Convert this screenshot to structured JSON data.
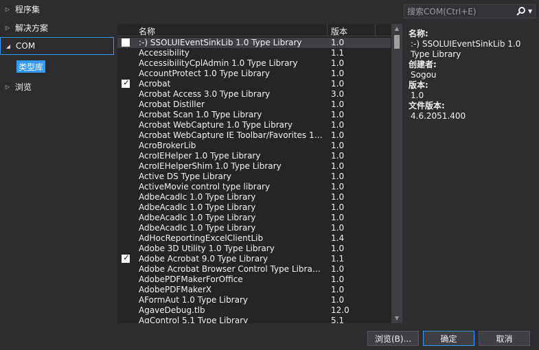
{
  "nav": {
    "items": [
      {
        "label": "程序集",
        "arrow": "▷"
      },
      {
        "label": "解决方案",
        "arrow": "▷"
      },
      {
        "label": "COM",
        "arrow": "◢"
      },
      {
        "label": "浏览",
        "arrow": "▷"
      }
    ],
    "child_label": "类型库"
  },
  "search": {
    "placeholder": "搜索COM(Ctrl+E)"
  },
  "list": {
    "columns": {
      "name": "名称",
      "version": "版本"
    },
    "rows": [
      {
        "name": ":-) SSOLUIEventSinkLib 1.0 Type Library",
        "version": "1.0",
        "checked": false,
        "selected": true
      },
      {
        "name": "Accessibility",
        "version": "1.1"
      },
      {
        "name": "AccessibilityCplAdmin 1.0 Type Library",
        "version": "1.0"
      },
      {
        "name": "AccountProtect 1.0 Type Library",
        "version": "1.0"
      },
      {
        "name": "Acrobat",
        "version": "1.0",
        "checked": true
      },
      {
        "name": "Acrobat Access 3.0 Type Library",
        "version": "3.0"
      },
      {
        "name": "Acrobat Distiller",
        "version": "1.0"
      },
      {
        "name": "Acrobat Scan 1.0 Type Library",
        "version": "1.0"
      },
      {
        "name": "Acrobat WebCapture 1.0 Type Library",
        "version": "1.0"
      },
      {
        "name": "Acrobat WebCapture IE Toolbar/Favorites 1.0 Ty...",
        "version": "1.0"
      },
      {
        "name": "AcroBrokerLib",
        "version": "1.0"
      },
      {
        "name": "AcroIEHelper 1.0 Type Library",
        "version": "1.0"
      },
      {
        "name": "AcroIEHelperShim 1.0 Type Library",
        "version": "1.0"
      },
      {
        "name": "Active DS Type Library",
        "version": "1.0"
      },
      {
        "name": "ActiveMovie control type library",
        "version": "1.0"
      },
      {
        "name": "AdbeAcadIc 1.0 Type Library",
        "version": "1.0"
      },
      {
        "name": "AdbeAcadIc 1.0 Type Library",
        "version": "1.0"
      },
      {
        "name": "AdbeAcadIc 1.0 Type Library",
        "version": "1.0"
      },
      {
        "name": "AdbeAcadIc 1.0 Type Library",
        "version": "1.0"
      },
      {
        "name": "AdHocReportingExcelClientLib",
        "version": "1.4"
      },
      {
        "name": "Adobe 3D Utility 1.0 Type Library",
        "version": "1.0"
      },
      {
        "name": "Adobe Acrobat 9.0 Type Library",
        "version": "1.1",
        "checked": true
      },
      {
        "name": "Adobe Acrobat Browser Control Type Library 1.0",
        "version": "1.0"
      },
      {
        "name": "AdobePDFMakerForOffice",
        "version": "1.0"
      },
      {
        "name": "AdobePDFMakerX",
        "version": "1.0"
      },
      {
        "name": "AFormAut 1.0 Type Library",
        "version": "1.0"
      },
      {
        "name": "AgaveDebug.tlb",
        "version": "12.0"
      },
      {
        "name": "AgControl 5.1 Type Library",
        "version": "5.1"
      }
    ]
  },
  "details": {
    "name_label": "名称:",
    "name_value": ":-) SSOLUIEventSinkLib 1.0 Type Library",
    "creator_label": "创建者:",
    "creator_value": "Sogou",
    "version_label": "版本:",
    "version_value": "1.0",
    "file_version_label": "文件版本:",
    "file_version_value": "4.6.2051.400"
  },
  "buttons": {
    "browse": "浏览(B)...",
    "ok": "确定",
    "cancel": "取消"
  },
  "colors": {
    "background": "#2d2d30",
    "list_background": "#252526",
    "accent": "#3399ff",
    "selected_row": "#3f3f46"
  }
}
